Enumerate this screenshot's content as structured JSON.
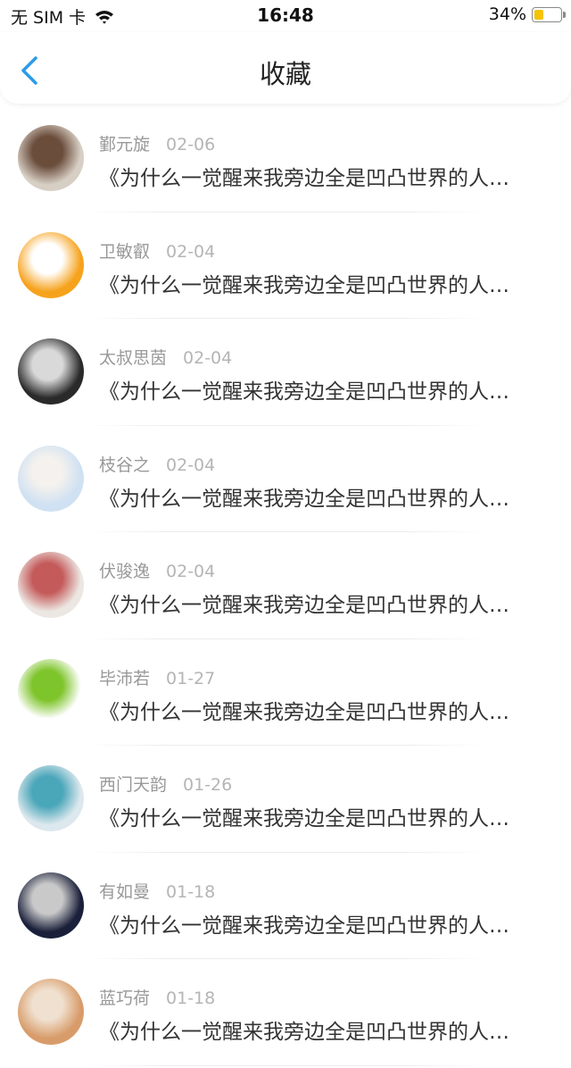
{
  "status_bar": {
    "carrier": "无 SIM 卡",
    "time": "16:48",
    "battery": "34%",
    "battery_level": 0.34
  },
  "header": {
    "back_icon": "chevron-left-icon",
    "title": "收藏"
  },
  "favorites": [
    {
      "name": "鄞元旋",
      "date": "02-06",
      "title": "《为什么一觉醒来我旁边全是凹凸世界的人…",
      "avatar_colors": [
        "#d7cfc4",
        "#6b4d3c"
      ]
    },
    {
      "name": "卫敏叡",
      "date": "02-04",
      "title": "《为什么一觉醒来我旁边全是凹凸世界的人…",
      "avatar_colors": [
        "#f6a21c",
        "#ffffff"
      ]
    },
    {
      "name": "太叔思茵",
      "date": "02-04",
      "title": "《为什么一觉醒来我旁边全是凹凸世界的人…",
      "avatar_colors": [
        "#2a2a2a",
        "#d9d9d9"
      ]
    },
    {
      "name": "枝谷之",
      "date": "02-04",
      "title": "《为什么一觉醒来我旁边全是凹凸世界的人…",
      "avatar_colors": [
        "#cfe1f2",
        "#f4f1ee"
      ]
    },
    {
      "name": "伏骏逸",
      "date": "02-04",
      "title": "《为什么一觉醒来我旁边全是凹凸世界的人…",
      "avatar_colors": [
        "#ece7e2",
        "#c45a5a"
      ]
    },
    {
      "name": "毕沛若",
      "date": "01-27",
      "title": "《为什么一觉醒来我旁边全是凹凸世界的人…",
      "avatar_colors": [
        "#ffffff",
        "#7ec42b"
      ]
    },
    {
      "name": "西门天韵",
      "date": "01-26",
      "title": "《为什么一觉醒来我旁边全是凹凸世界的人…",
      "avatar_colors": [
        "#dde8ee",
        "#4aa6b9"
      ]
    },
    {
      "name": "有如曼",
      "date": "01-18",
      "title": "《为什么一觉醒来我旁边全是凹凸世界的人…",
      "avatar_colors": [
        "#1a1f3a",
        "#c9c9c9"
      ]
    },
    {
      "name": "蓝巧荷",
      "date": "01-18",
      "title": "《为什么一觉醒来我旁边全是凹凸世界的人…",
      "avatar_colors": [
        "#d89c6a",
        "#f0e0cf"
      ]
    }
  ]
}
